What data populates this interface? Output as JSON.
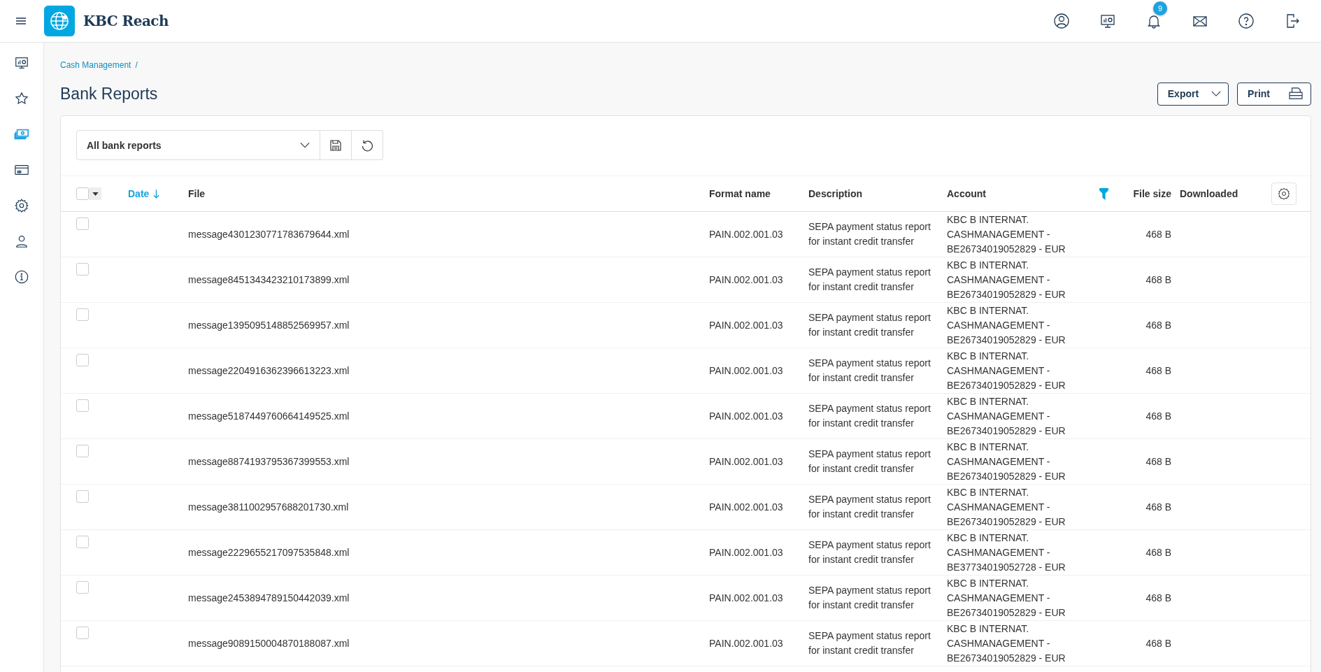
{
  "app": {
    "name": "KBC Reach"
  },
  "top_bar": {
    "notification_count": "9"
  },
  "sidebar": {
    "items": [
      {
        "selected": false
      },
      {
        "selected": false
      },
      {
        "selected": true
      },
      {
        "selected": false
      },
      {
        "selected": false
      },
      {
        "selected": false
      },
      {
        "selected": false
      }
    ]
  },
  "breadcrumb": [
    "Cash Management",
    "/"
  ],
  "page_title": "Bank Reports",
  "actions": [
    {
      "label": "Export",
      "kind": "dropdown"
    },
    {
      "label": "Print",
      "kind": "print"
    }
  ],
  "view_select": {
    "value": "All bank reports"
  },
  "table": {
    "columns": [
      {
        "label": "Date",
        "sorted": true,
        "filtered": false
      },
      {
        "label": "File",
        "sorted": false,
        "filtered": false
      },
      {
        "label": "Format name",
        "sorted": false,
        "filtered": false
      },
      {
        "label": "Description",
        "sorted": false,
        "filtered": false
      },
      {
        "label": "Account",
        "sorted": false,
        "filtered": true
      },
      {
        "label": "File size",
        "sorted": false,
        "filtered": false
      },
      {
        "label": "Downloaded",
        "sorted": false,
        "filtered": false
      }
    ],
    "select_all_checked": false,
    "rows": [
      {
        "checked": false,
        "file": "message4301230771783679644.xml",
        "format": "PAIN.002.001.03",
        "description": "SEPA payment status report for instant credit transfer",
        "account": "KBC B INTERNAT. CASHMANAGEMENT - BE26734019052829 - EUR",
        "size": "468 B"
      },
      {
        "checked": false,
        "file": "message8451343423210173899.xml",
        "format": "PAIN.002.001.03",
        "description": "SEPA payment status report for instant credit transfer",
        "account": "KBC B INTERNAT. CASHMANAGEMENT - BE26734019052829 - EUR",
        "size": "468 B"
      },
      {
        "checked": false,
        "file": "message1395095148852569957.xml",
        "format": "PAIN.002.001.03",
        "description": "SEPA payment status report for instant credit transfer",
        "account": "KBC B INTERNAT. CASHMANAGEMENT - BE26734019052829 - EUR",
        "size": "468 B"
      },
      {
        "checked": false,
        "file": "message2204916362396613223.xml",
        "format": "PAIN.002.001.03",
        "description": "SEPA payment status report for instant credit transfer",
        "account": "KBC B INTERNAT. CASHMANAGEMENT - BE26734019052829 - EUR",
        "size": "468 B"
      },
      {
        "checked": false,
        "file": "message5187449760664149525.xml",
        "format": "PAIN.002.001.03",
        "description": "SEPA payment status report for instant credit transfer",
        "account": "KBC B INTERNAT. CASHMANAGEMENT - BE26734019052829 - EUR",
        "size": "468 B"
      },
      {
        "checked": false,
        "file": "message8874193795367399553.xml",
        "format": "PAIN.002.001.03",
        "description": "SEPA payment status report for instant credit transfer",
        "account": "KBC B INTERNAT. CASHMANAGEMENT - BE26734019052829 - EUR",
        "size": "468 B"
      },
      {
        "checked": false,
        "file": "message3811002957688201730.xml",
        "format": "PAIN.002.001.03",
        "description": "SEPA payment status report for instant credit transfer",
        "account": "KBC B INTERNAT. CASHMANAGEMENT - BE26734019052829 - EUR",
        "size": "468 B"
      },
      {
        "checked": false,
        "file": "message2229655217097535848.xml",
        "format": "PAIN.002.001.03",
        "description": "SEPA payment status report for instant credit transfer",
        "account": "KBC B INTERNAT. CASHMANAGEMENT - BE37734019052728 - EUR",
        "size": "468 B"
      },
      {
        "checked": false,
        "file": "message2453894789150442039.xml",
        "format": "PAIN.002.001.03",
        "description": "SEPA payment status report for instant credit transfer",
        "account": "KBC B INTERNAT. CASHMANAGEMENT - BE26734019052829 - EUR",
        "size": "468 B"
      },
      {
        "checked": false,
        "file": "message9089150004870188087.xml",
        "format": "PAIN.002.001.03",
        "description": "SEPA payment status report for instant credit transfer",
        "account": "KBC B INTERNAT. CASHMANAGEMENT - BE26734019052829 - EUR",
        "size": "468 B"
      }
    ]
  }
}
